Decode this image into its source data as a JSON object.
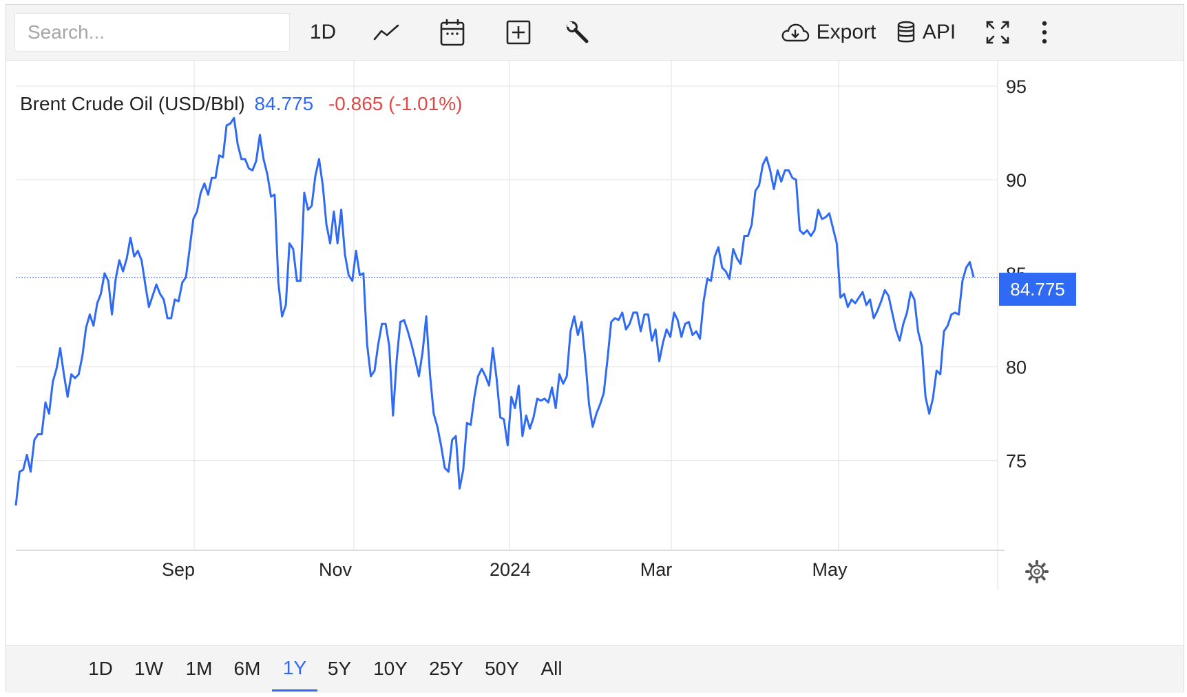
{
  "toolbar": {
    "search_placeholder": "Search...",
    "interval_label": "1D",
    "export_label": "Export",
    "api_label": "API",
    "icons": [
      "line-chart-icon",
      "calendar-icon",
      "plus-box-icon",
      "wrench-icon",
      "cloud-download-icon",
      "database-icon",
      "fullscreen-icon",
      "more-vertical-icon"
    ]
  },
  "header": {
    "instrument": "Brent Crude Oil (USD/Bbl)",
    "price": "84.775",
    "change": "-0.865 (-1.01%)"
  },
  "last_price_badge": "84.775",
  "ranges": {
    "items": [
      "1D",
      "1W",
      "1M",
      "6M",
      "1Y",
      "5Y",
      "10Y",
      "25Y",
      "50Y",
      "All"
    ],
    "active": "1Y"
  },
  "colors": {
    "line": "#2f6af5",
    "negative": "#e04848",
    "grid": "#e6e6e6"
  },
  "chart_data": {
    "type": "line",
    "title": "Brent Crude Oil (USD/Bbl)",
    "xlabel": "",
    "ylabel": "",
    "x_tick_labels": [
      "Sep",
      "Nov",
      "2024",
      "Mar",
      "May"
    ],
    "y_ticks": [
      75,
      80,
      85,
      90,
      95
    ],
    "ylim": [
      70.2,
      96.4
    ],
    "grid": true,
    "last_value": 84.775,
    "series": [
      {
        "values": [
          72.6,
          74.4,
          74.5,
          75.3,
          74.4,
          76.1,
          76.4,
          76.4,
          78.1,
          77.5,
          79.2,
          79.9,
          81.0,
          79.6,
          78.4,
          79.6,
          79.4,
          79.6,
          80.6,
          82.1,
          82.8,
          82.2,
          83.4,
          83.9,
          85.0,
          84.6,
          82.8,
          84.7,
          85.7,
          85.1,
          85.8,
          86.9,
          85.9,
          86.2,
          85.7,
          84.4,
          83.2,
          83.8,
          84.4,
          83.9,
          83.6,
          82.6,
          82.6,
          83.6,
          83.5,
          84.5,
          84.8,
          86.3,
          87.9,
          88.3,
          89.3,
          89.8,
          89.2,
          90.1,
          90.1,
          91.3,
          91.2,
          92.9,
          93.0,
          93.3,
          91.9,
          91.1,
          91.1,
          90.6,
          90.5,
          91.0,
          92.4,
          91.1,
          90.3,
          89.1,
          89.2,
          84.5,
          82.7,
          83.3,
          86.6,
          86.3,
          84.6,
          84.6,
          89.3,
          88.4,
          88.6,
          90.2,
          91.1,
          89.7,
          87.6,
          86.6,
          88.3,
          86.6,
          88.4,
          86.0,
          84.9,
          84.6,
          86.2,
          84.9,
          85.0,
          81.2,
          79.5,
          79.8,
          81.2,
          82.3,
          82.3,
          81.1,
          77.4,
          80.4,
          82.4,
          82.5,
          81.9,
          81.2,
          80.4,
          79.5,
          80.8,
          82.7,
          79.6,
          77.5,
          76.8,
          75.8,
          74.6,
          74.4,
          76.1,
          76.3,
          73.5,
          74.5,
          77.0,
          76.9,
          78.4,
          79.5,
          79.9,
          79.5,
          79.0,
          81.0,
          79.4,
          77.3,
          77.2,
          75.8,
          78.4,
          77.8,
          79.0,
          76.3,
          77.4,
          76.7,
          77.3,
          78.3,
          78.2,
          78.3,
          78.1,
          78.9,
          77.8,
          79.6,
          79.1,
          79.5,
          81.9,
          82.7,
          81.7,
          82.4,
          80.4,
          78.0,
          76.8,
          77.5,
          78.0,
          78.6,
          80.4,
          82.4,
          82.6,
          82.5,
          82.9,
          82.0,
          82.3,
          82.9,
          82.9,
          81.9,
          82.8,
          82.8,
          81.4,
          82.0,
          80.3,
          81.3,
          82.0,
          81.6,
          82.9,
          82.5,
          81.6,
          82.3,
          82.4,
          81.7,
          81.9,
          81.5,
          83.5,
          84.7,
          84.6,
          85.9,
          86.4,
          85.3,
          85.1,
          84.7,
          86.3,
          85.8,
          85.5,
          87.0,
          87.0,
          87.6,
          89.4,
          89.7,
          90.8,
          91.2,
          90.5,
          89.5,
          90.5,
          89.9,
          90.5,
          90.5,
          90.1,
          90.0,
          87.3,
          87.1,
          87.3,
          87.0,
          87.3,
          88.4,
          87.9,
          88.0,
          88.2,
          87.4,
          86.6,
          83.7,
          83.9,
          83.2,
          83.6,
          83.4,
          83.7,
          84.0,
          83.3,
          83.6,
          82.6,
          83.0,
          83.5,
          84.1,
          83.8,
          82.9,
          82.0,
          81.4,
          82.3,
          82.9,
          84.0,
          83.6,
          81.9,
          81.1,
          78.4,
          77.5,
          78.3,
          79.8,
          79.6,
          81.9,
          82.2,
          82.8,
          82.9,
          82.8,
          84.6,
          85.3,
          85.6,
          84.8
        ]
      }
    ]
  }
}
